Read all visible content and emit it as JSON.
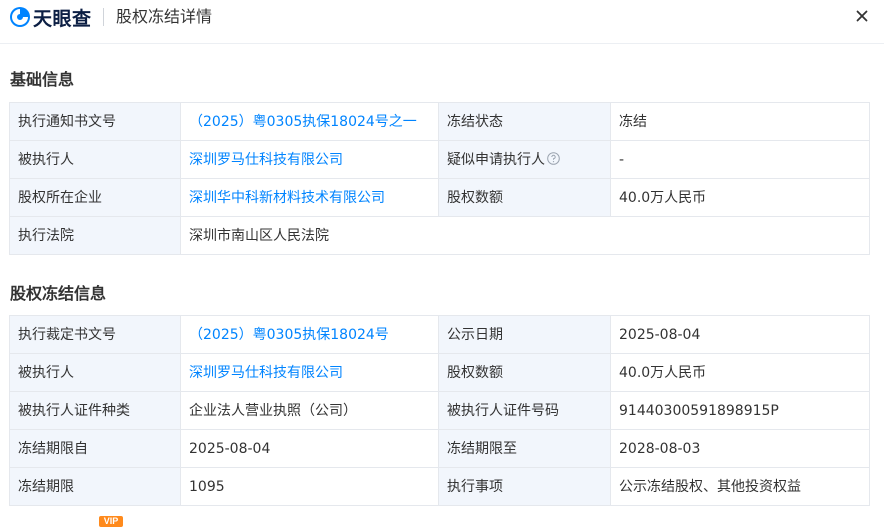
{
  "header": {
    "brand": "天眼查",
    "title": "股权冻结详情"
  },
  "colors": {
    "accent": "#0084ff",
    "label_bg": "#f2f6fc",
    "border": "#e5e8ed",
    "brand_dark": "#0c1f44",
    "vip": "#ff8a1c"
  },
  "basic": {
    "title": "基础信息",
    "rows": [
      {
        "l1": "执行通知书文号",
        "v1": "（2025）粤0305执保18024号之一",
        "l2": "冻结状态",
        "v2": "冻结"
      },
      {
        "l1": "被执行人",
        "v1": "深圳罗马仕科技有限公司",
        "l2": "疑似申请执行人",
        "v2": "-"
      },
      {
        "l1": "股权所在企业",
        "v1": "深圳华中科新材料技术有限公司",
        "l2": "股权数额",
        "v2": "40.0万人民币"
      },
      {
        "l1": "执行法院",
        "v1": "深圳市南山区人民法院"
      }
    ]
  },
  "freeze": {
    "title": "股权冻结信息",
    "rows": [
      {
        "l1": "执行裁定书文号",
        "v1": "（2025）粤0305执保18024号",
        "l2": "公示日期",
        "v2": "2025-08-04"
      },
      {
        "l1": "被执行人",
        "v1": "深圳罗马仕科技有限公司",
        "l2": "股权数额",
        "v2": "40.0万人民币"
      },
      {
        "l1": "被执行人证件种类",
        "v1": "企业法人营业执照（公司）",
        "l2": "被执行人证件号码",
        "v2": "91440300591898915P"
      },
      {
        "l1": "冻结期限自",
        "v1": "2025-08-04",
        "l2": "冻结期限至",
        "v2": "2028-08-03"
      },
      {
        "l1": "冻结期限",
        "v1": "1095",
        "l2": "执行事项",
        "v2": "公示冻结股权、其他投资权益"
      }
    ]
  },
  "footer": {
    "vip_badge": "VIP"
  }
}
